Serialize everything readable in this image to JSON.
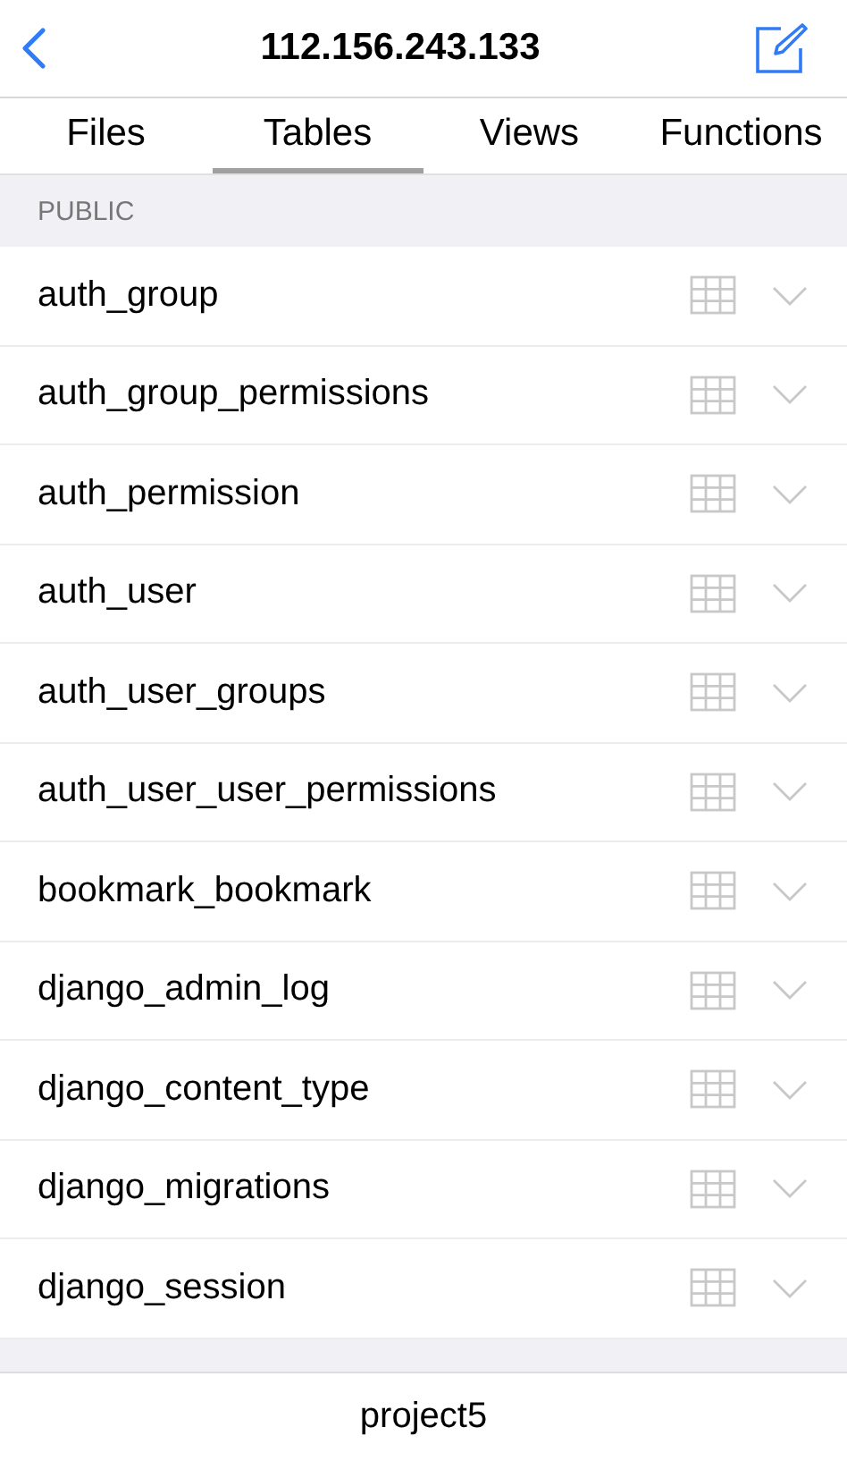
{
  "nav": {
    "title": "112.156.243.133"
  },
  "tabs": [
    {
      "label": "Files",
      "selected": false
    },
    {
      "label": "Tables",
      "selected": true
    },
    {
      "label": "Views",
      "selected": false
    },
    {
      "label": "Functions",
      "selected": false
    }
  ],
  "section": {
    "title": "PUBLIC"
  },
  "tables": [
    {
      "name": "auth_group"
    },
    {
      "name": "auth_group_permissions"
    },
    {
      "name": "auth_permission"
    },
    {
      "name": "auth_user"
    },
    {
      "name": "auth_user_groups"
    },
    {
      "name": "auth_user_user_permissions"
    },
    {
      "name": "bookmark_bookmark"
    },
    {
      "name": "django_admin_log"
    },
    {
      "name": "django_content_type"
    },
    {
      "name": "django_migrations"
    },
    {
      "name": "django_session"
    }
  ],
  "footer": {
    "label": "project5"
  }
}
